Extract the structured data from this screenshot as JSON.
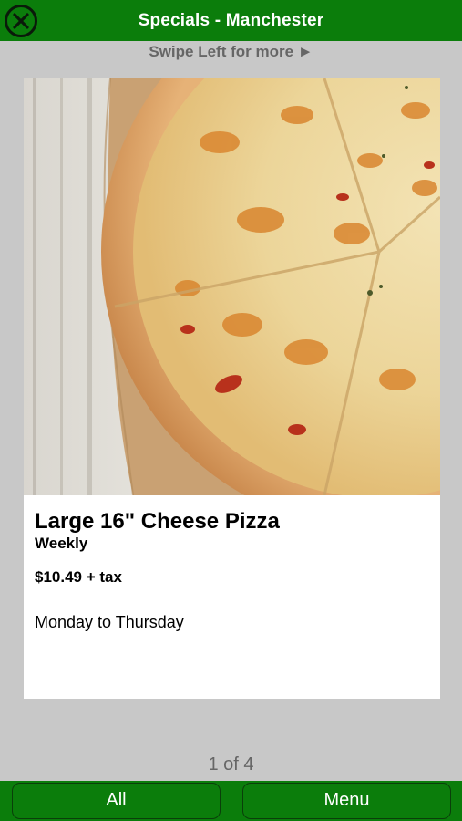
{
  "header": {
    "title": "Specials - Manchester"
  },
  "swipe_hint": "Swipe Left for more ►",
  "special": {
    "title": "Large 16\" Cheese Pizza",
    "frequency": "Weekly",
    "price": "$10.49 + tax",
    "days": "Monday to Thursday"
  },
  "pager": "1 of 4",
  "bottom_bar": {
    "all_label": "All",
    "menu_label": "Menu"
  },
  "colors": {
    "brand_green": "#0b7d0b",
    "background_gray": "#c8c8c8"
  },
  "icons": {
    "close": "close-circle-icon"
  }
}
